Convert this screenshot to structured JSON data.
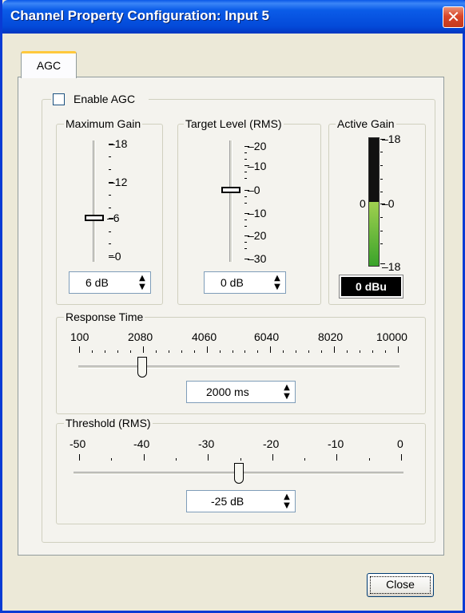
{
  "window": {
    "title": "Channel Property Configuration: Input 5",
    "close_glyph": "✕"
  },
  "tabs": [
    {
      "label": "AGC"
    }
  ],
  "agc": {
    "enable_label": "Enable AGC",
    "enabled": false,
    "maximum_gain": {
      "legend": "Maximum Gain",
      "scale_labels": [
        "–18",
        "–12",
        "–6",
        "–0"
      ],
      "value_text": "6 dB",
      "value": 6,
      "range": [
        0,
        18
      ]
    },
    "target_level": {
      "legend": "Target Level (RMS)",
      "scale_labels": [
        "–20",
        "–10",
        "–0",
        "–10",
        "–20",
        "–30"
      ],
      "value_text": "0 dB",
      "value": 0,
      "range": [
        -30,
        20
      ]
    },
    "active_gain": {
      "legend": "Active Gain",
      "scale_labels": [
        "–18",
        "–0",
        "–18"
      ],
      "zero_label": "0",
      "readout": "0 dBu",
      "level_fraction": 0.5
    },
    "response_time": {
      "legend": "Response Time",
      "scale_labels": [
        "100",
        "2080",
        "4060",
        "6040",
        "8020",
        "10000"
      ],
      "value_text": "2000 ms",
      "value": 2000,
      "range": [
        100,
        10000
      ]
    },
    "threshold": {
      "legend": "Threshold (RMS)",
      "scale_labels": [
        "-50",
        "-40",
        "-30",
        "-20",
        "-10",
        "0"
      ],
      "value_text": "-25 dB",
      "value": -25,
      "range": [
        -50,
        0
      ]
    }
  },
  "spin_up_glyph": "▲",
  "spin_down_glyph": "▼",
  "footer": {
    "close_label": "Close"
  }
}
